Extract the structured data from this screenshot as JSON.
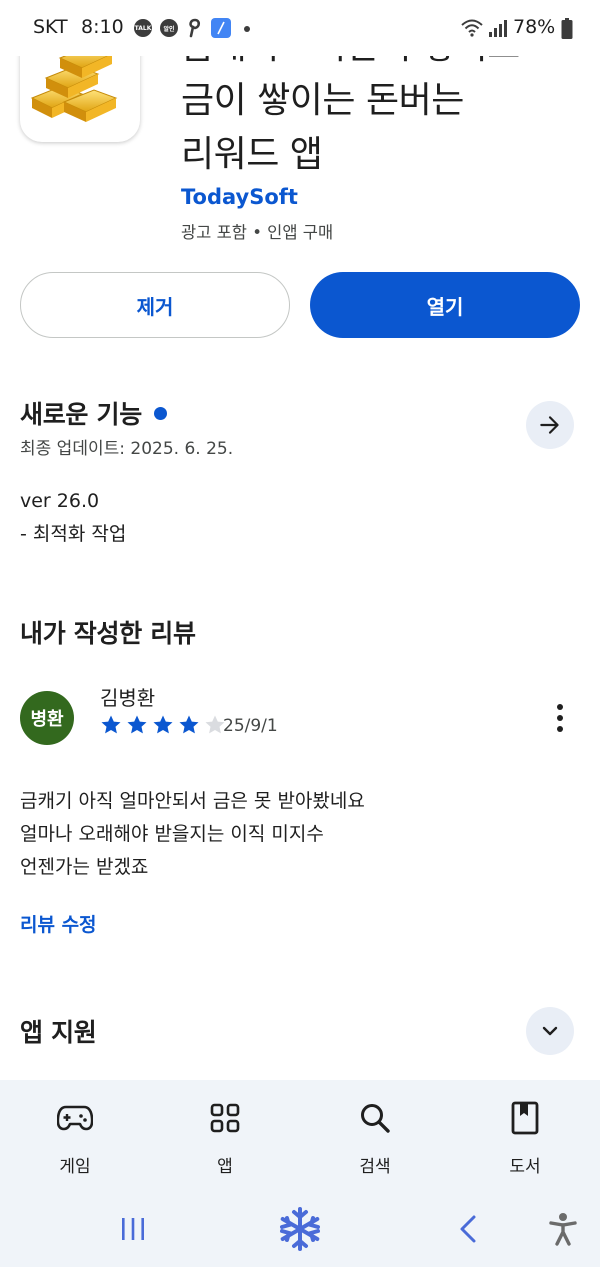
{
  "status_bar": {
    "carrier": "SKT",
    "time": "8:10",
    "talk_badge": "TALK",
    "alert_badge": "알인",
    "battery": "78%"
  },
  "app": {
    "title": "금캐기 - 기간이 쌓이고\n금이 쌓이는 돈버는\n리워드 앱",
    "developer": "TodaySoft",
    "meta": "광고 포함 • 인앱 구매"
  },
  "buttons": {
    "remove": "제거",
    "open": "열기"
  },
  "whats_new": {
    "title": "새로운 기능",
    "last_updated": "최종 업데이트: 2025. 6. 25.",
    "notes": "ver 26.0\n- 최적화 작업"
  },
  "my_review": {
    "section_title": "내가 작성한 리뷰",
    "avatar_text": "병환",
    "reviewer": "김병환",
    "rating": 4,
    "max_rating": 5,
    "date": "25/9/1",
    "text": "금캐기  아직 얼마안되서 금은 못 받아봤네요\n얼마나 오래해야 받을지는 이직 미지수\n언젠가는 받겠죠",
    "edit_link": "리뷰 수정"
  },
  "app_support": {
    "title": "앱 지원"
  },
  "bottom_nav": [
    {
      "label": "게임",
      "icon": "gamepad-icon"
    },
    {
      "label": "앱",
      "icon": "apps-grid-icon"
    },
    {
      "label": "검색",
      "icon": "search-icon"
    },
    {
      "label": "도서",
      "icon": "book-icon"
    }
  ],
  "colors": {
    "accent": "#0b57d0",
    "avatar": "#33691e",
    "nav_background": "#f0f4f9",
    "star_empty": "#dadce0"
  }
}
